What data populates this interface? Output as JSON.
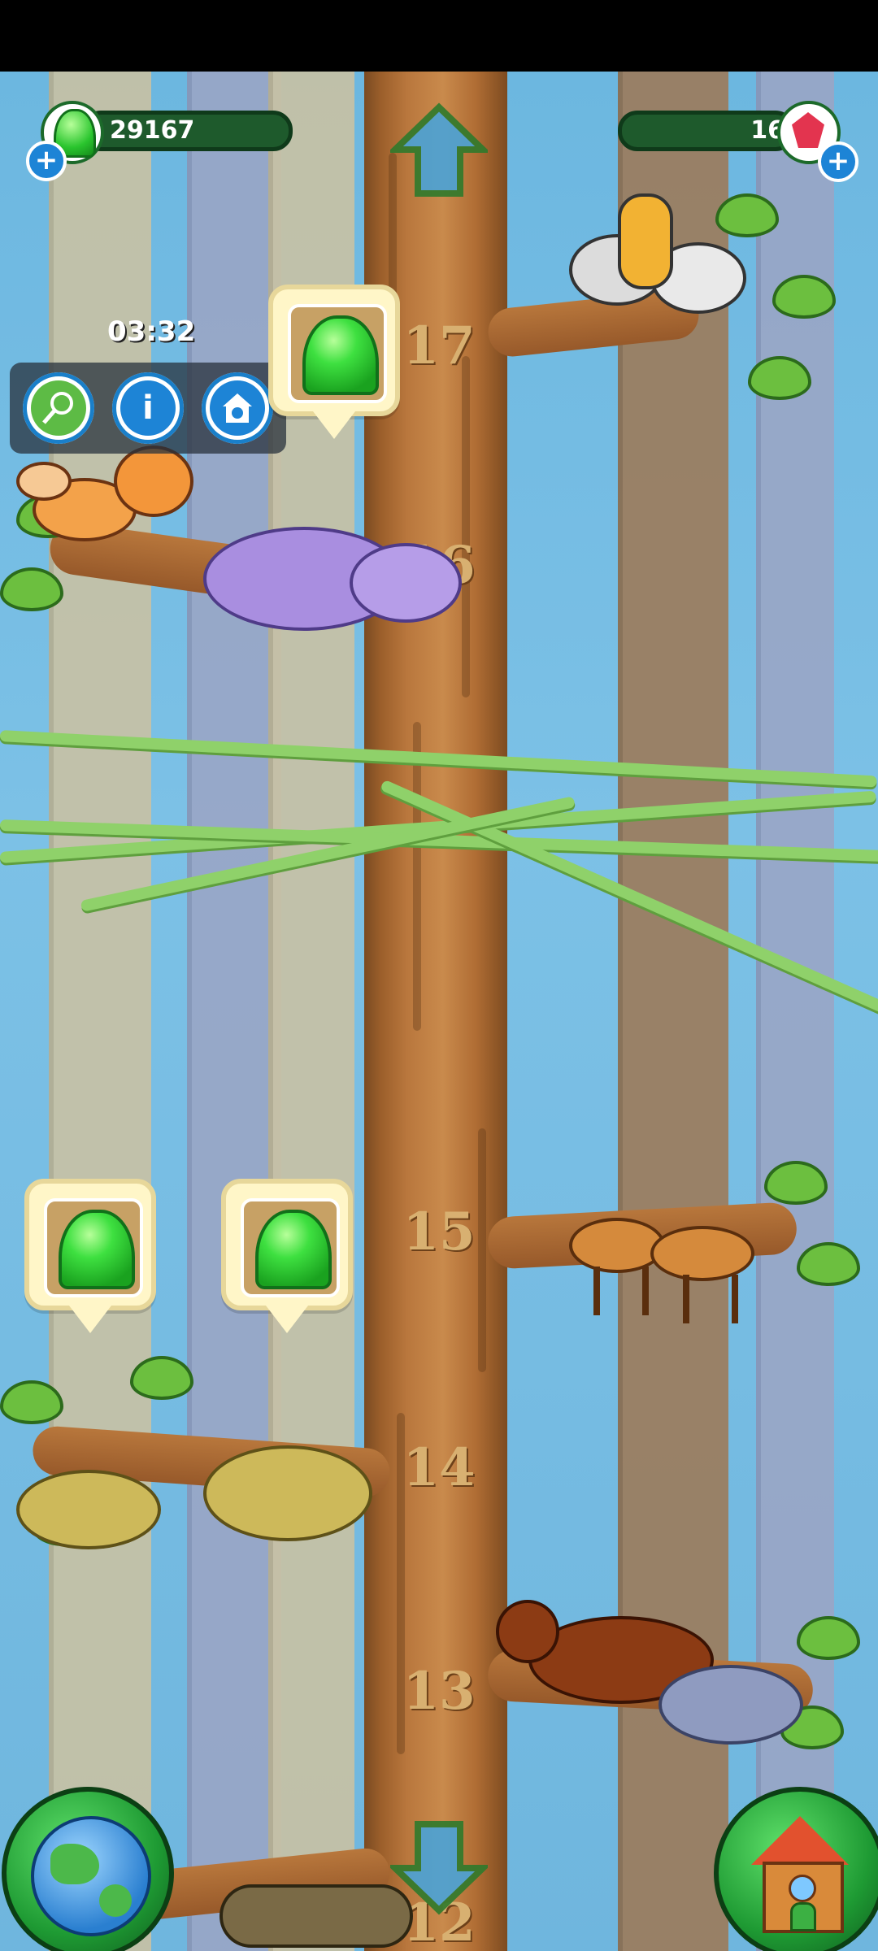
{
  "hud": {
    "slime_count": "29167",
    "gem_count": "16"
  },
  "timer": "03:32",
  "action_panel": {
    "buttons": [
      {
        "name": "net-button",
        "icon": "butterfly-net-icon"
      },
      {
        "name": "info-button",
        "icon": "info-icon",
        "glyph": "i"
      },
      {
        "name": "habitat-button",
        "icon": "animal-house-icon"
      }
    ]
  },
  "levels": [
    "17",
    "16",
    "15",
    "14",
    "13",
    "12"
  ],
  "navigation": {
    "up": "up-arrow-icon",
    "down": "down-arrow-icon",
    "world": "globe-icon",
    "home": "birdhouse-icon"
  },
  "colors": {
    "slime_green": "#3ee040",
    "gem_red": "#e3344f",
    "plus_blue": "#1d84d6",
    "hud_bar": "#1e5a2c"
  }
}
